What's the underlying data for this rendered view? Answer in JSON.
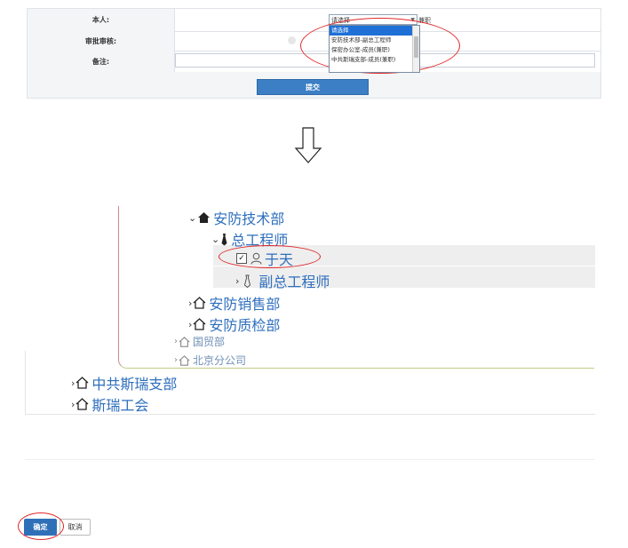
{
  "form": {
    "self_label": "本人:",
    "review_label": "审批审核:",
    "note_label": "备注:",
    "select_value": "请选择",
    "select_suffix": "兼职",
    "dropdown_options": [
      "请选择",
      "安防技术部-副总工程师",
      "保密办公室-成员(兼职)",
      "中共斯瑞支部-成员(兼职)"
    ],
    "submit_label": "提交"
  },
  "tree": {
    "dept_security_tech": "安防技术部",
    "chief_engineer": "总工程师",
    "person": "于天",
    "deputy_chief_engineer": "副总工程师",
    "dept_security_sales": "安防销售部",
    "dept_security_qc": "安防质检部",
    "dept_trade": "国贸部",
    "beijing_branch": "北京分公司",
    "party_branch": "中共斯瑞支部",
    "union": "斯瑞工会"
  },
  "footer": {
    "confirm_label": "确定",
    "cancel_label": "取消"
  },
  "colors": {
    "accent": "#3d7fc4",
    "annotation": "#e0282a",
    "tree_text": "#2f6fbd"
  }
}
